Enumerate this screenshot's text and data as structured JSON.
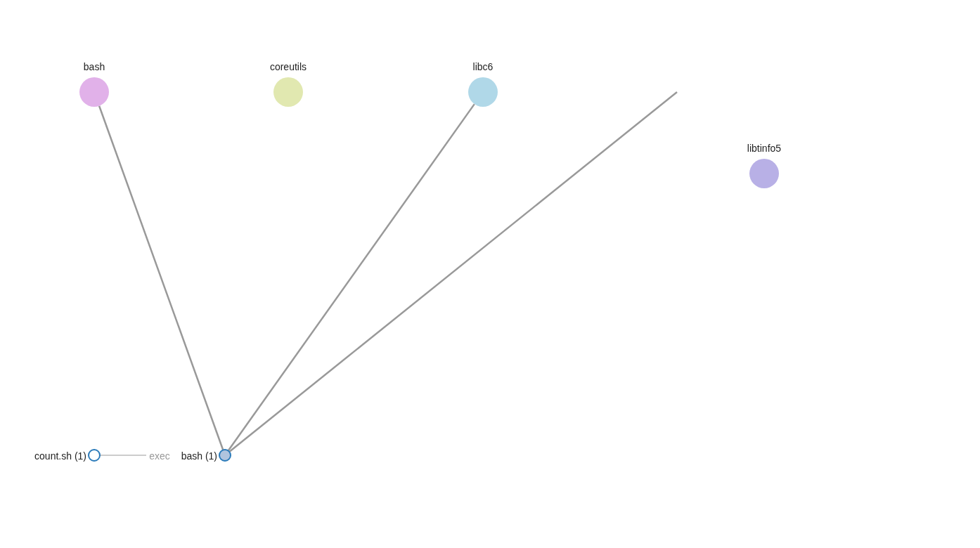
{
  "packages": [
    {
      "name": "bash",
      "color": "#e1b1e9"
    },
    {
      "name": "coreutils",
      "color": "#e1e8b0"
    },
    {
      "name": "libc6",
      "color": "#b0d8e8"
    },
    {
      "name": "libtinfo5",
      "color": "#b8b0e6"
    }
  ],
  "processes": [
    {
      "label": "count.sh (1)",
      "active": false
    },
    {
      "label": "bash (1)",
      "active": true
    }
  ],
  "exec_link": {
    "label": "exec"
  }
}
